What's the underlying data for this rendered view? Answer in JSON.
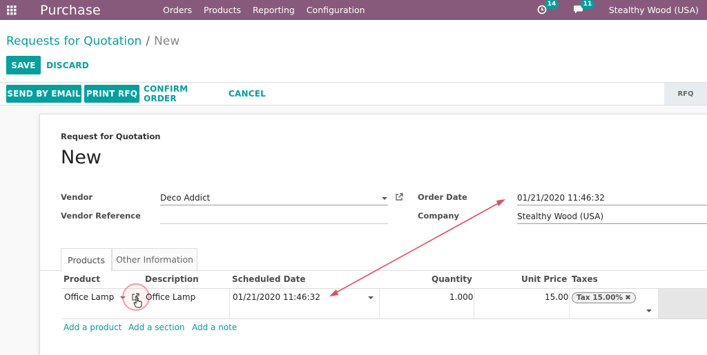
{
  "navbar": {
    "app_name": "Purchase",
    "menu": [
      "Orders",
      "Products",
      "Reporting",
      "Configuration"
    ],
    "activity_count": "14",
    "message_count": "11",
    "company": "Stealthy Wood (USA)",
    "bg_color": "#875a7b"
  },
  "breadcrumb": {
    "parent": "Requests for Quotation",
    "separator": "/",
    "current": "New"
  },
  "buttons": {
    "save": "SAVE",
    "discard": "DISCARD",
    "send_by_email": "SEND BY EMAIL",
    "print_rfq": "PRINT RFQ",
    "confirm_order": "CONFIRM ORDER",
    "cancel": "CANCEL"
  },
  "status": {
    "current_step": "RFQ"
  },
  "form": {
    "subtitle": "Request for Quotation",
    "title": "New",
    "vendor_label": "Vendor",
    "vendor_value": "Deco Addict",
    "vendor_ref_label": "Vendor Reference",
    "vendor_ref_value": "",
    "order_date_label": "Order Date",
    "order_date_value": "01/21/2020 11:46:32",
    "company_label": "Company",
    "company_value": "Stealthy Wood (USA)"
  },
  "tabs": [
    "Products",
    "Other Information"
  ],
  "table": {
    "headers": [
      "Product",
      "Description",
      "Scheduled Date",
      "Quantity",
      "Unit Price",
      "Taxes"
    ],
    "row": {
      "product": "Office Lamp",
      "description": "Office Lamp",
      "scheduled_date": "01/21/2020 11:46:32",
      "quantity": "1.000",
      "unit_price": "15.00",
      "tax": "Tax 15.00%"
    },
    "add_links": [
      "Add a product",
      "Add a section",
      "Add a note"
    ]
  },
  "colors": {
    "accent": "#00a09d",
    "annotation": "#e8485f"
  }
}
